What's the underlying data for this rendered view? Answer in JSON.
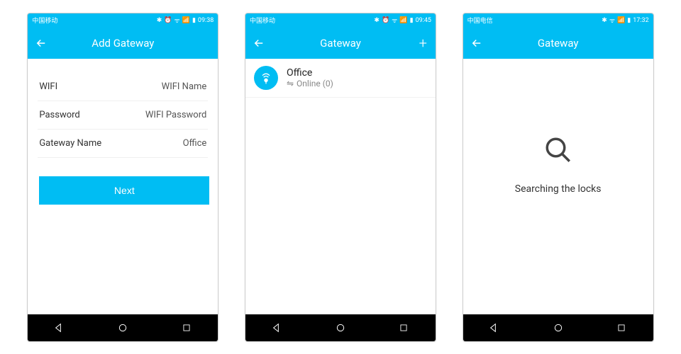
{
  "screen1": {
    "statusbar": {
      "carrier": "中国移动",
      "time": "09:38"
    },
    "header": {
      "title": "Add Gateway"
    },
    "form": {
      "row1": {
        "label": "WIFI",
        "value": "WIFI Name"
      },
      "row2": {
        "label": "Password",
        "value": "WIFI Password"
      },
      "row3": {
        "label": "Gateway Name",
        "value": "Office"
      }
    },
    "button": {
      "label": "Next"
    }
  },
  "screen2": {
    "statusbar": {
      "carrier": "中国移动",
      "time": "09:45"
    },
    "header": {
      "title": "Gateway"
    },
    "item": {
      "name": "Office",
      "status": "Online (0)"
    }
  },
  "screen3": {
    "statusbar": {
      "carrier": "中国电信",
      "time": "17:32"
    },
    "header": {
      "title": "Gateway"
    },
    "searching": {
      "text": "Searching the locks"
    }
  }
}
